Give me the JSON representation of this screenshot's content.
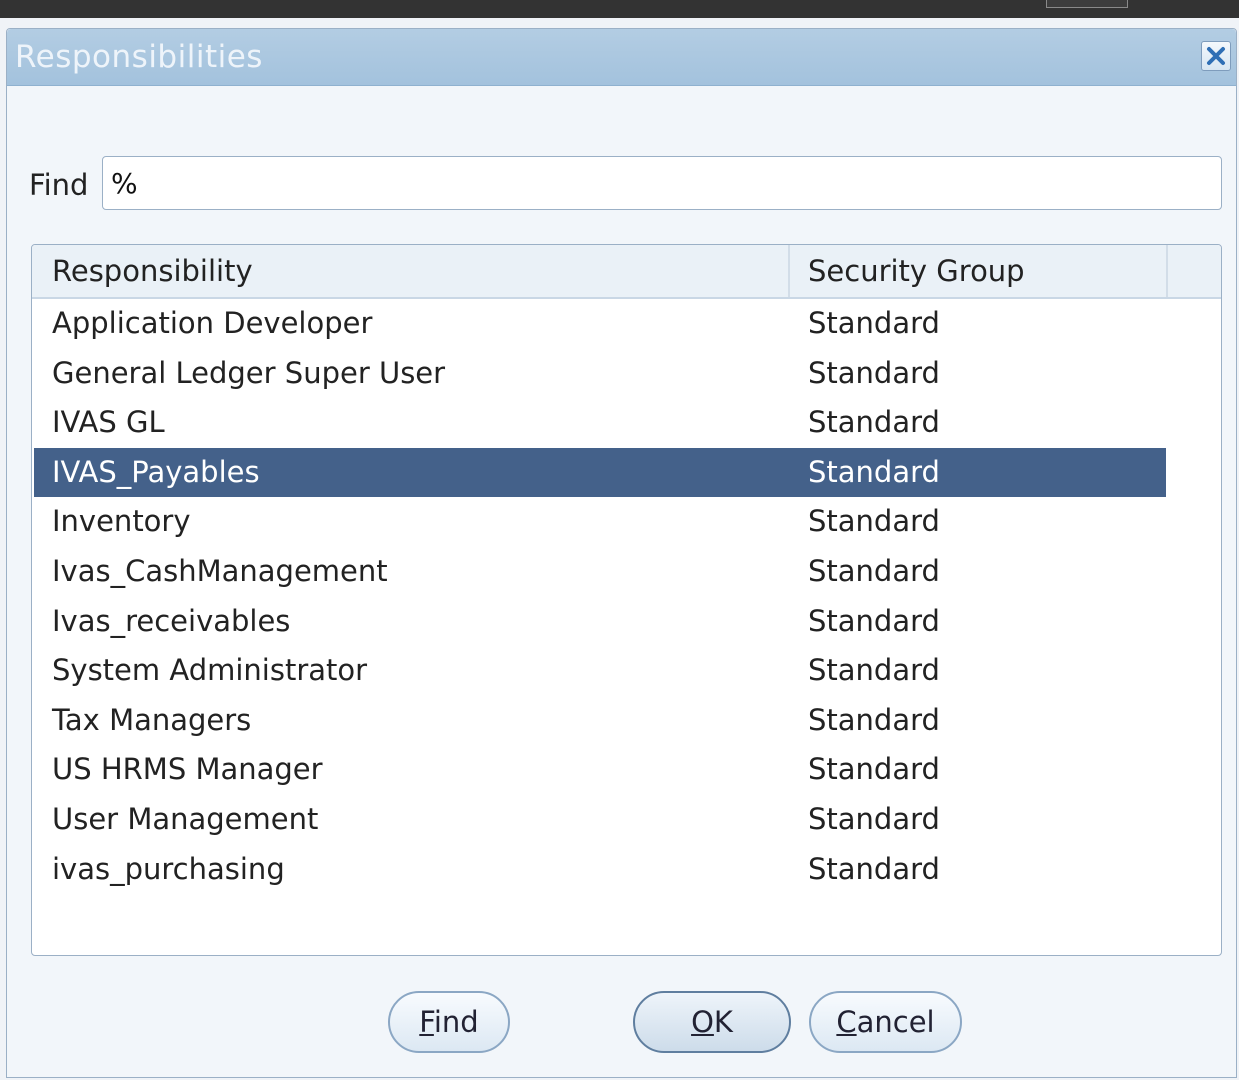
{
  "dialog": {
    "title": "Responsibilities"
  },
  "find": {
    "label": "Find",
    "value": "%"
  },
  "table": {
    "columns": [
      "Responsibility",
      "Security Group"
    ],
    "rows": [
      {
        "responsibility": "Application Developer",
        "security_group": "Standard"
      },
      {
        "responsibility": "General Ledger Super User",
        "security_group": "Standard"
      },
      {
        "responsibility": "IVAS GL",
        "security_group": "Standard"
      },
      {
        "responsibility": "IVAS_Payables",
        "security_group": "Standard",
        "selected": true
      },
      {
        "responsibility": "Inventory",
        "security_group": "Standard"
      },
      {
        "responsibility": "Ivas_CashManagement",
        "security_group": "Standard"
      },
      {
        "responsibility": "Ivas_receivables",
        "security_group": "Standard"
      },
      {
        "responsibility": "System Administrator",
        "security_group": "Standard"
      },
      {
        "responsibility": "Tax Managers",
        "security_group": "Standard"
      },
      {
        "responsibility": "US HRMS Manager",
        "security_group": "Standard"
      },
      {
        "responsibility": "User Management",
        "security_group": "Standard"
      },
      {
        "responsibility": "ivas_purchasing",
        "security_group": "Standard"
      }
    ]
  },
  "buttons": {
    "find": {
      "mnemonic": "F",
      "rest": "ind"
    },
    "ok": {
      "mnemonic": "O",
      "rest": "K"
    },
    "cancel": {
      "mnemonic": "C",
      "rest": "ancel"
    }
  },
  "colors": {
    "selected_row": "#44618a",
    "titlebar": "#a3c2dd"
  }
}
